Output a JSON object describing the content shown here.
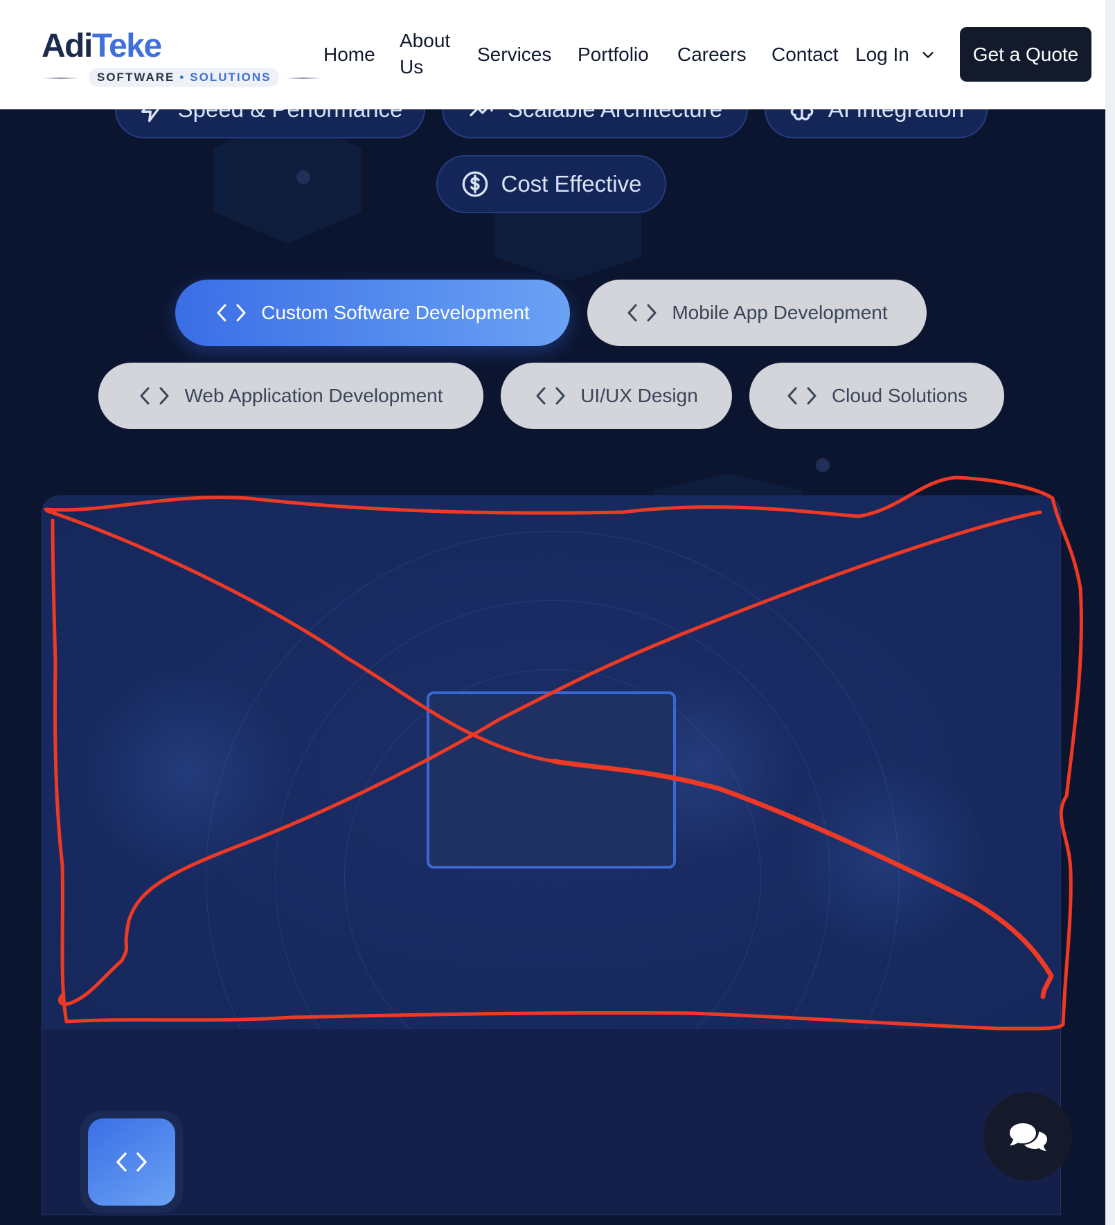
{
  "brand": {
    "name_part1": "Adi",
    "name_part2": "Teke",
    "tagline_left": "SOFTWARE",
    "tagline_separator": "•",
    "tagline_right": "SOLUTIONS"
  },
  "nav": {
    "items": [
      {
        "label": "Home"
      },
      {
        "label": "About Us"
      },
      {
        "label": "Services"
      },
      {
        "label": "Portfolio"
      },
      {
        "label": "Careers"
      },
      {
        "label": "Contact"
      }
    ],
    "login_label": "Log In",
    "cta_label": "Get a Quote"
  },
  "features": [
    {
      "label": "Speed & Performance",
      "icon": "lightning-icon"
    },
    {
      "label": "Scalable Architecture",
      "icon": "trend-up-icon"
    },
    {
      "label": "AI Integration",
      "icon": "brain-icon"
    },
    {
      "label": "Cost Effective",
      "icon": "dollar-circle-icon"
    }
  ],
  "service_tabs": [
    {
      "label": "Custom Software Development",
      "active": true,
      "icon": "code-icon"
    },
    {
      "label": "Mobile App Development",
      "active": false,
      "icon": "code-icon"
    },
    {
      "label": "Web Application Development",
      "active": false,
      "icon": "code-icon"
    },
    {
      "label": "UI/UX Design",
      "active": false,
      "icon": "code-icon"
    },
    {
      "label": "Cloud Solutions",
      "active": false,
      "icon": "code-icon"
    }
  ],
  "colors": {
    "page_background": "#0c1530",
    "accent": "#3b6ee6",
    "annotation": "#ee3a24",
    "header_background": "#ffffff",
    "cta_background": "#131a2b"
  }
}
